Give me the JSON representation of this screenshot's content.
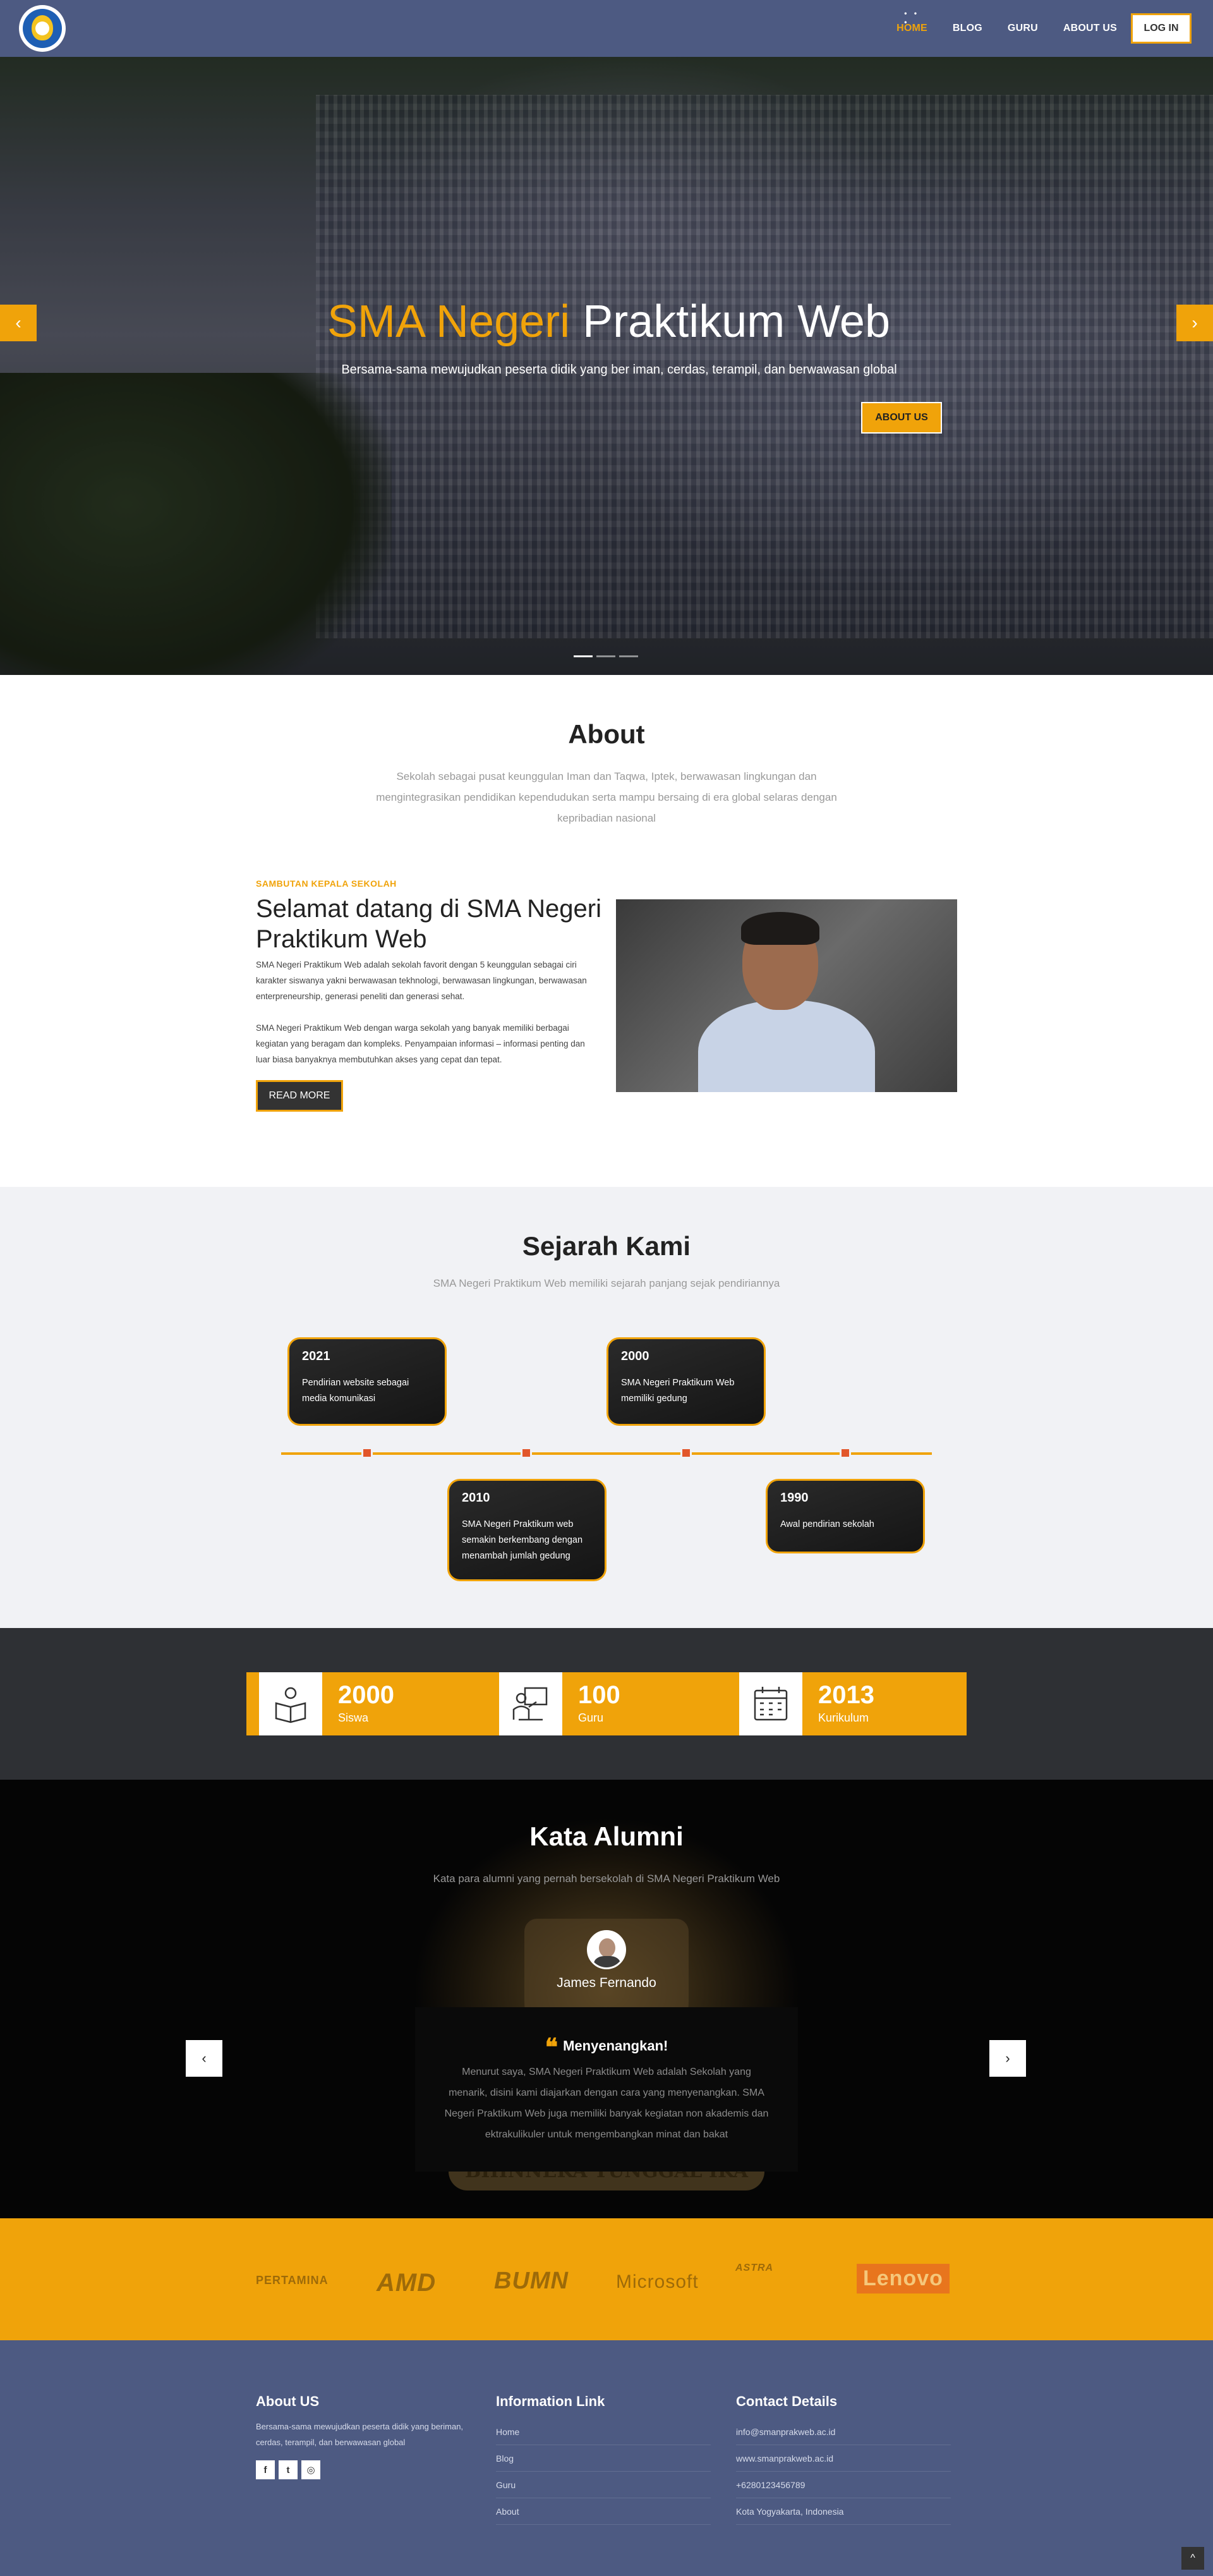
{
  "nav": {
    "items": [
      {
        "label": "HOME",
        "active": true
      },
      {
        "label": "BLOG"
      },
      {
        "label": "GURU"
      },
      {
        "label": "ABOUT US"
      }
    ],
    "login_label": "LOG IN",
    "active_dots": "• • •"
  },
  "hero": {
    "title_accent": "SMA Negeri",
    "title_rest": "Praktikum Web",
    "subtitle": "Bersama-sama mewujudkan peserta didik yang ber iman, cerdas, terampil, dan berwawasan global",
    "button_label": "ABOUT US",
    "arrow_left": "‹",
    "arrow_right": "›"
  },
  "about": {
    "title": "About",
    "subtitle": "Sekolah sebagai pusat keunggulan Iman dan Taqwa, Iptek, berwawasan lingkungan dan mengintegrasikan pendidikan kependudukan serta mampu bersaing di era global selaras dengan kepribadian nasional",
    "kicker": "SAMBUTAN KEPALA SEKOLAH",
    "welcome_title": "Selamat datang di SMA Negeri Praktikum Web",
    "paragraph1": "SMA Negeri Praktikum Web adalah sekolah favorit dengan 5 keunggulan sebagai ciri karakter siswanya yakni berwawasan tekhnologi, berwawasan lingkungan, berwawasan enterpreneurship, generasi peneliti dan generasi sehat.",
    "paragraph2": "SMA Negeri Praktikum Web dengan warga sekolah yang banyak memiliki berbagai kegiatan yang beragam dan kompleks. Penyampaian informasi – informasi penting dan luar biasa banyaknya membutuhkan akses yang cepat dan tepat.",
    "read_more": "READ MORE"
  },
  "sejarah": {
    "title": "Sejarah Kami",
    "subtitle": "SMA Negeri Praktikum Web memiliki sejarah panjang sejak pendiriannya",
    "events": [
      {
        "year": "2021",
        "desc": "Pendirian website sebagai media komunikasi"
      },
      {
        "year": "2010",
        "desc": "SMA Negeri Praktikum web semakin berkembang dengan menambah jumlah gedung"
      },
      {
        "year": "2000",
        "desc": "SMA Negeri Praktikum Web memiliki gedung"
      },
      {
        "year": "1990",
        "desc": "Awal pendirian sekolah"
      }
    ]
  },
  "stats": [
    {
      "number": "2000",
      "label": "Siswa",
      "icon": "reading-book-icon"
    },
    {
      "number": "100",
      "label": "Guru",
      "icon": "teacher-board-icon"
    },
    {
      "number": "2013",
      "label": "Kurikulum",
      "icon": "calendar-icon"
    }
  ],
  "alumni": {
    "title": "Kata Alumni",
    "subtitle": "Kata para alumni yang pernah bersekolah di SMA Negeri Praktikum Web",
    "name": "James Fernando",
    "quote_mark": "❝",
    "quote_title": "Menyenangkan!",
    "quote_text": "Menurut saya, SMA Negeri Praktikum Web adalah Sekolah yang menarik, disini kami diajarkan dengan cara yang menyenangkan. SMA Negeri Praktikum Web juga memiliki banyak kegiatan non akademis dan ektrakulikuler untuk mengembangkan minat dan bakat",
    "motto": "BHINNEKA TUNGGAL IKA",
    "arrow_left": "‹",
    "arrow_right": "›"
  },
  "partners": [
    "PERTAMINA",
    "AMD",
    "BUMN",
    "Microsoft",
    "ASTRA",
    "Lenovo"
  ],
  "footer": {
    "about_title": "About US",
    "about_text": "Bersama-sama mewujudkan peserta didik yang beriman, cerdas, terampil, dan berwawasan global",
    "socials": [
      "f",
      "t",
      "◎"
    ],
    "links_title": "Information Link",
    "links": [
      "Home",
      "Blog",
      "Guru",
      "About"
    ],
    "contact_title": "Contact Details",
    "contacts": [
      "info@smanprakweb.ac.id",
      "www.smanprakweb.ac.id",
      "+6280123456789",
      "Kota Yogyakarta, Indonesia"
    ],
    "to_top": "^"
  },
  "colors": {
    "accent": "#f0a30a",
    "nav": "#4d5a82",
    "timeline_node": "#e2562a"
  }
}
